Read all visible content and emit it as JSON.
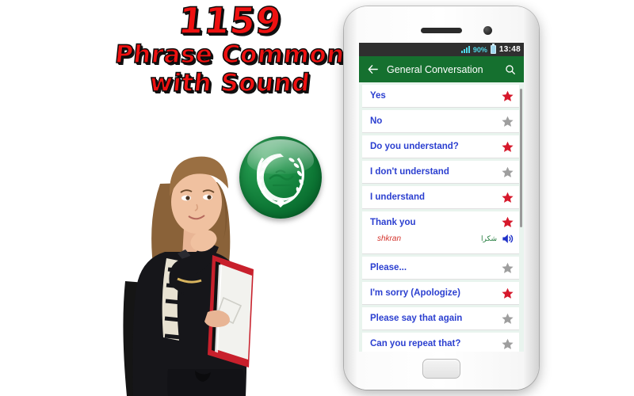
{
  "promo": {
    "line1": "1159",
    "line2": "Phrase Common",
    "line3": "with Sound",
    "text_color": "#ee1111",
    "shadow_color": "#111111"
  },
  "badge": {
    "name": "arab-league-emblem",
    "color": "#0f7a37"
  },
  "phone": {
    "statusbar": {
      "signal_icon": "signal-bars-icon",
      "battery_percent": "90%",
      "battery_icon": "battery-icon",
      "clock": "13:48",
      "background": "#2f2f2f",
      "accent": "#4fd8e8"
    },
    "appbar": {
      "back_icon": "back-arrow-icon",
      "title": "General Conversation",
      "search_icon": "search-icon",
      "background": "#15702f"
    },
    "list": {
      "star_on_color": "#d6182b",
      "star_off_color": "#9e9e9e",
      "label_color": "#2b3fd0",
      "items": [
        {
          "label": "Yes",
          "starred": true,
          "expanded": false
        },
        {
          "label": "No",
          "starred": false,
          "expanded": false
        },
        {
          "label": "Do you understand?",
          "starred": true,
          "expanded": false
        },
        {
          "label": "I don't understand",
          "starred": false,
          "expanded": false
        },
        {
          "label": "I understand",
          "starred": true,
          "expanded": false
        },
        {
          "label": "Thank you",
          "starred": true,
          "expanded": true,
          "native": "شكرا",
          "transliteration": "shkran",
          "speaker_icon": "speaker-icon"
        },
        {
          "label": "Please...",
          "starred": false,
          "expanded": false
        },
        {
          "label": "I'm sorry (Apologize)",
          "starred": true,
          "expanded": false
        },
        {
          "label": "Please say that again",
          "starred": false,
          "expanded": false
        },
        {
          "label": "Can you repeat that?",
          "starred": false,
          "expanded": false
        }
      ]
    }
  }
}
